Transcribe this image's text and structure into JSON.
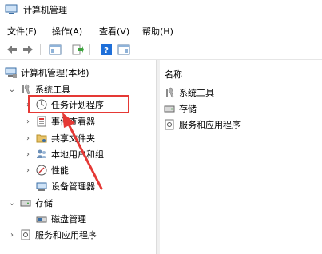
{
  "window": {
    "title": "计算机管理"
  },
  "menu": [
    {
      "label": "文件(F)"
    },
    {
      "label": "操作(A)"
    },
    {
      "label": "查看(V)"
    },
    {
      "label": "帮助(H)"
    }
  ],
  "tree": {
    "root": "计算机管理(本地)",
    "system_tools": "系统工具",
    "task_scheduler": "任务计划程序",
    "event_viewer": "事件查看器",
    "shared_folders": "共享文件夹",
    "local_users": "本地用户和组",
    "performance": "性能",
    "device_manager": "设备管理器",
    "storage": "存储",
    "disk_management": "磁盘管理",
    "services_apps": "服务和应用程序"
  },
  "right": {
    "column_header": "名称",
    "items": [
      "系统工具",
      "存储",
      "服务和应用程序"
    ]
  },
  "colors": {
    "highlight": "#e53935",
    "accent": "#1e6fd9"
  }
}
